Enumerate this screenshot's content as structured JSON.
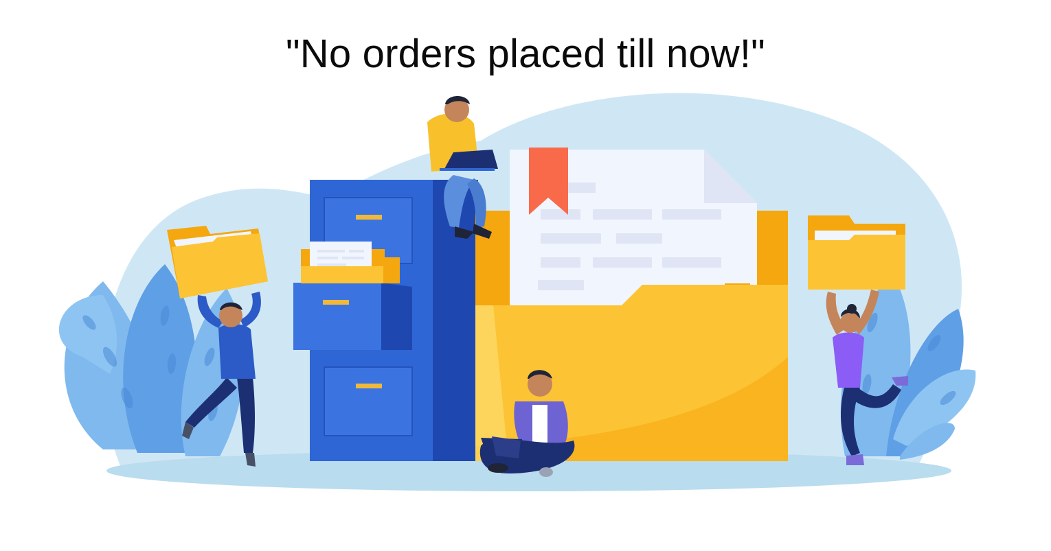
{
  "empty_state": {
    "message": "\"No orders placed till now!\""
  },
  "illustration": {
    "colors": {
      "background_blob": "#cfe7f5",
      "ground_shadow": "#b9dcee",
      "leaf_light": "#7fb9ee",
      "leaf_dark": "#5e9fe6",
      "cabinet_front": "#2f66d6",
      "cabinet_side": "#1e47b0",
      "drawer_handle": "#f0b93b",
      "folder_yellow": "#fcc434",
      "folder_orange": "#f5a70f",
      "paper": "#f1f5fd",
      "paper_line": "#dfe5f4",
      "bookmark": "#f96a4a",
      "shirt_yellow": "#f8c12b",
      "sweater_blue": "#2c5ac6",
      "jacket_purple": "#6d63d2",
      "top_violet": "#8b5cf6",
      "pants_navy": "#1d2f73",
      "skin": "#c4855b",
      "hair": "#1f2436"
    }
  }
}
